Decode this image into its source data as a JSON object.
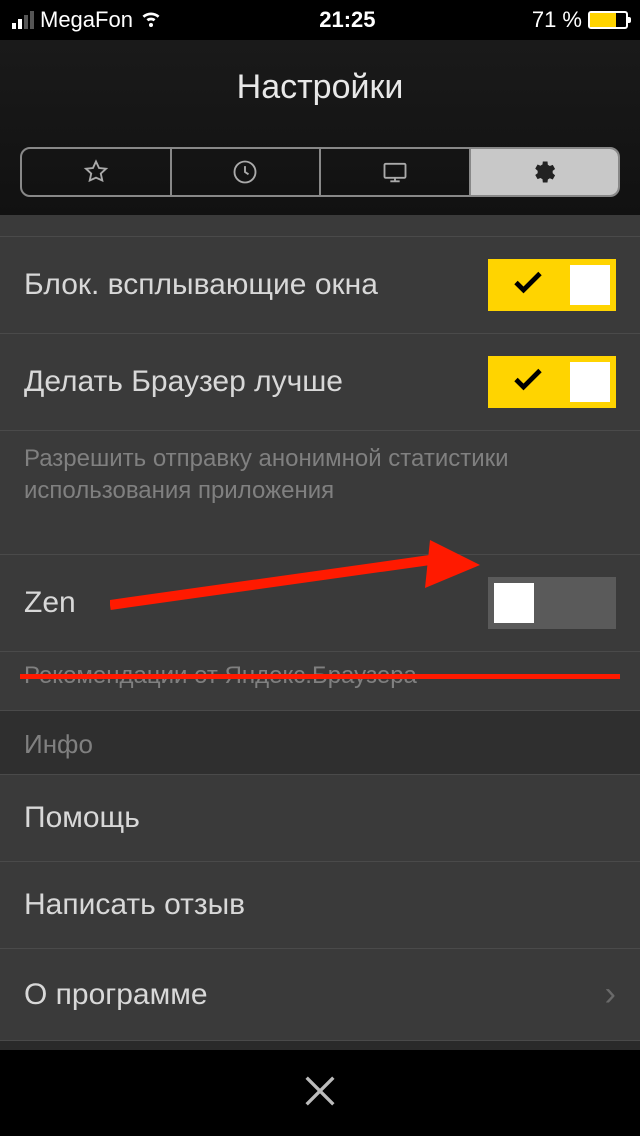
{
  "status": {
    "carrier": "MegaFon",
    "time": "21:25",
    "battery_percent": "71 %"
  },
  "header": {
    "title": "Настройки"
  },
  "tabs": {
    "star": "star-icon",
    "clock": "clock-icon",
    "monitor": "monitor-icon",
    "gear": "gear-icon"
  },
  "settings": {
    "block_popups": {
      "label": "Блок. всплывающие окна",
      "on": true
    },
    "improve_browser": {
      "label": "Делать Браузер лучше",
      "on": true,
      "sub": "Разрешить отправку анонимной статистики использования приложения"
    },
    "zen": {
      "label": "Zen",
      "on": false,
      "sub": "Рекомендации от Яндекс.Браузера"
    }
  },
  "info_section": {
    "header": "Инфо",
    "help": "Помощь",
    "feedback": "Написать отзыв",
    "about": "О программе"
  },
  "colors": {
    "accent": "#ffd400",
    "annotation": "#ff1a00"
  }
}
